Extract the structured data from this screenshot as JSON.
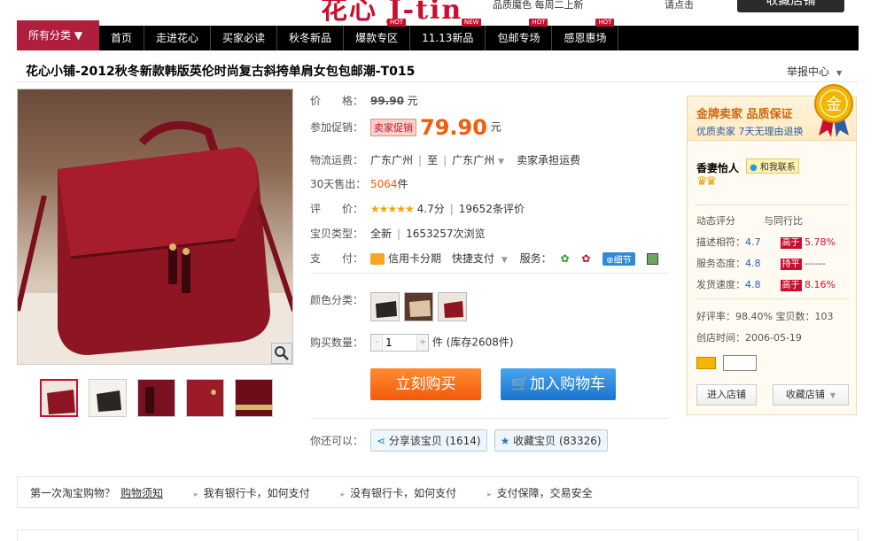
{
  "top": {
    "logo_text": "花心 J-tin",
    "slogan": "品质魔色 每周二上新",
    "login_text": "请点击",
    "favorite_shop": "收藏店铺"
  },
  "nav": {
    "all_categories": "所有分类 ▼",
    "items": [
      {
        "label": "首页",
        "hot": ""
      },
      {
        "label": "走进花心",
        "hot": ""
      },
      {
        "label": "买家必读",
        "hot": ""
      },
      {
        "label": "秋冬新品",
        "hot": ""
      },
      {
        "label": "爆款专区",
        "hot": "HOT"
      },
      {
        "label": "11.13新品",
        "hot": "NEW"
      },
      {
        "label": "包邮专场",
        "hot": "HOT"
      },
      {
        "label": "感恩惠场",
        "hot": "HOT"
      }
    ]
  },
  "product": {
    "title": "花心小铺-2012秋冬新款韩版英伦时尚复古斜挎单肩女包包邮潮-T015",
    "report": "举报中心",
    "price_label": "价　　格：",
    "orig_price": "99.90",
    "unit": "元",
    "promo_label": "参加促销：",
    "promo_tag": "卖家促销",
    "promo_price": "79.90",
    "shipping_label": "物流运费：",
    "ship_from": "广东广州",
    "ship_to_word": "至",
    "ship_to": "广东广州",
    "ship_note": "卖家承担运费",
    "sold_label": "30天售出：",
    "sold_count": "5064",
    "sold_unit": "件",
    "rating_label": "评　　价：",
    "stars": "★★★★★",
    "score": "4.7分",
    "reviews": "19652条评价",
    "type_label": "宝贝类型：",
    "type_value": "全新",
    "views": "1653257次浏览",
    "pay_label": "支　　付：",
    "pay_credit": "信用卡分期",
    "pay_quick": "快捷支付",
    "service_label": "服务：",
    "detail_btn": "细节",
    "color_label": "颜色分类：",
    "qty_label": "购买数量：",
    "qty_value": "1",
    "stock": "件 (库存2608件)",
    "buy_now": "立刻购买",
    "add_cart": "加入购物车",
    "also_label": "你还可以：",
    "share": "分享该宝贝 (1614)",
    "collect": "收藏宝贝 (83326)"
  },
  "seller": {
    "gold_title": "金牌卖家 品质保证",
    "gold_sub": "优质卖家 7天无理由退换",
    "medal_text": "金",
    "name": "香妻怡人",
    "chat": "和我联系",
    "dyn_title": "动态评分",
    "compare_title": "与同行比",
    "scores": [
      {
        "label": "描述相符：",
        "value": "4.7",
        "tag": "高于",
        "diff": "5.78%"
      },
      {
        "label": "服务态度：",
        "value": "4.8",
        "tag": "持平",
        "diff": "------"
      },
      {
        "label": "发货速度：",
        "value": "4.8",
        "tag": "高于",
        "diff": "8.16%"
      }
    ],
    "good_rate": "好评率：98.40%",
    "items_count": "宝贝数：103",
    "founded": "创店时间：2006-05-19",
    "enter_shop": "进入店铺",
    "collect_shop": "收藏店铺"
  },
  "bottom": {
    "first_time": "第一次淘宝购物？",
    "guide": "购物须知",
    "links": [
      "我有银行卡，如何支付",
      "没有银行卡，如何支付",
      "支付保障，交易安全"
    ]
  }
}
